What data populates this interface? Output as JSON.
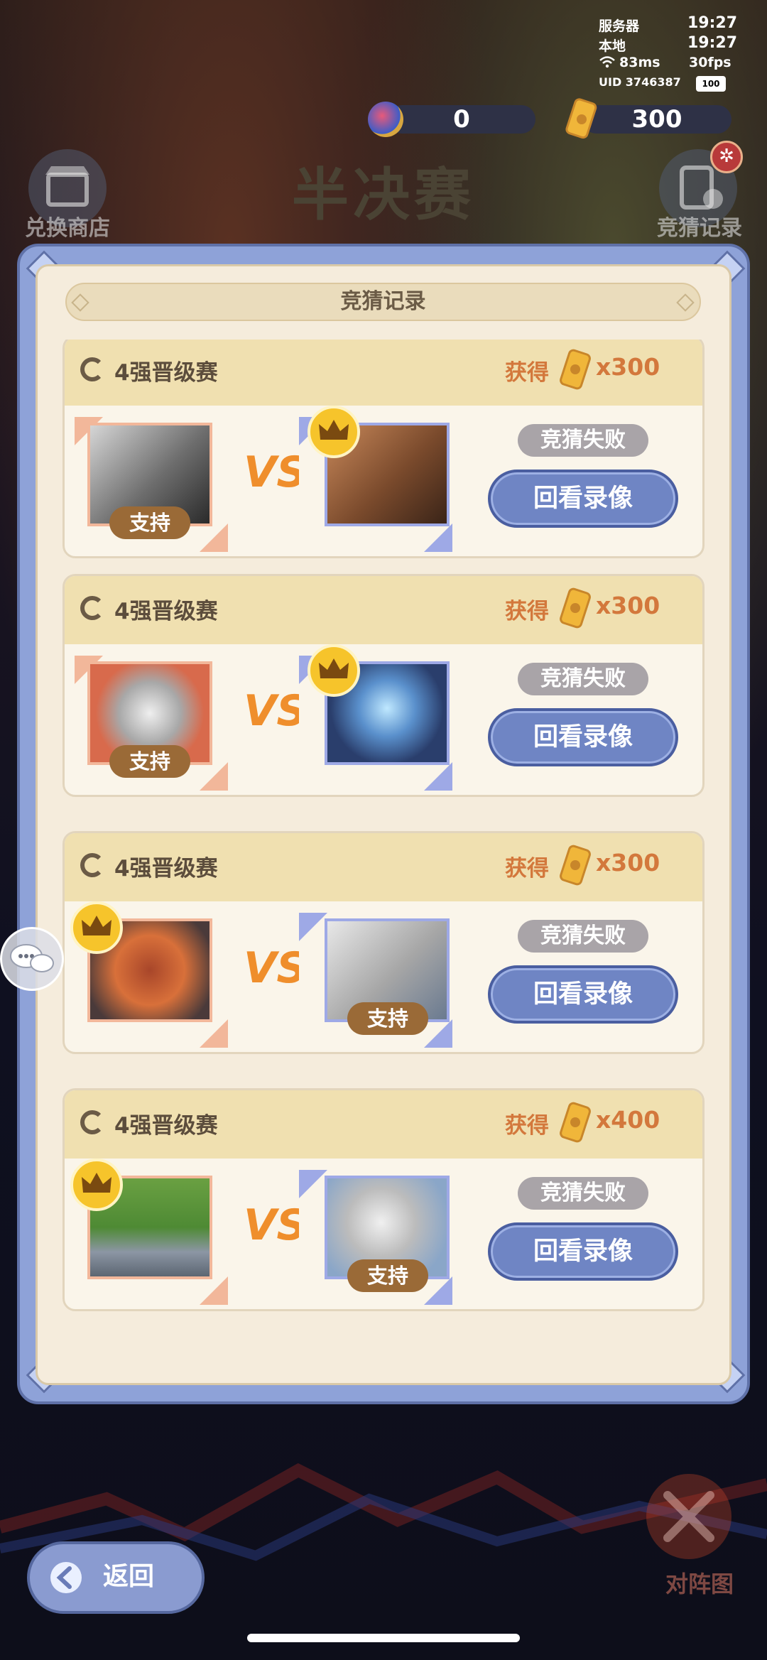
{
  "status": {
    "server_label": "服务器",
    "server_time": "19:27",
    "local_label": "本地",
    "local_time": "19:27",
    "ping": "83ms",
    "fps": "30fps",
    "uid": "UID 3746387",
    "battery": "100"
  },
  "currency": {
    "gems": "0",
    "tickets": "300"
  },
  "top": {
    "shop_label": "兑换商店",
    "title": "半决赛",
    "records_label": "竞猜记录"
  },
  "dialog": {
    "title": "竞猜记录",
    "records": [
      {
        "round": "4强晋级赛",
        "reward_label": "获得",
        "reward": "x300",
        "support_label": "支持",
        "result": "竞猜失败",
        "replay_label": "回看录像"
      },
      {
        "round": "4强晋级赛",
        "reward_label": "获得",
        "reward": "x300",
        "support_label": "支持",
        "result": "竞猜失败",
        "replay_label": "回看录像"
      },
      {
        "round": "4强晋级赛",
        "reward_label": "获得",
        "reward": "x300",
        "support_label": "支持",
        "result": "竞猜失败",
        "replay_label": "回看录像"
      },
      {
        "round": "4强晋级赛",
        "reward_label": "获得",
        "reward": "x400",
        "support_label": "支持",
        "result": "竞猜失败",
        "replay_label": "回看录像"
      }
    ]
  },
  "bottom": {
    "back_label": "返回",
    "battle_label": "对阵图"
  },
  "colors": {
    "accent_orange": "#d3783c",
    "button_blue": "#6f85c4",
    "panel_bg": "#f5ecdc",
    "frame_blue": "#8ea2d8"
  }
}
